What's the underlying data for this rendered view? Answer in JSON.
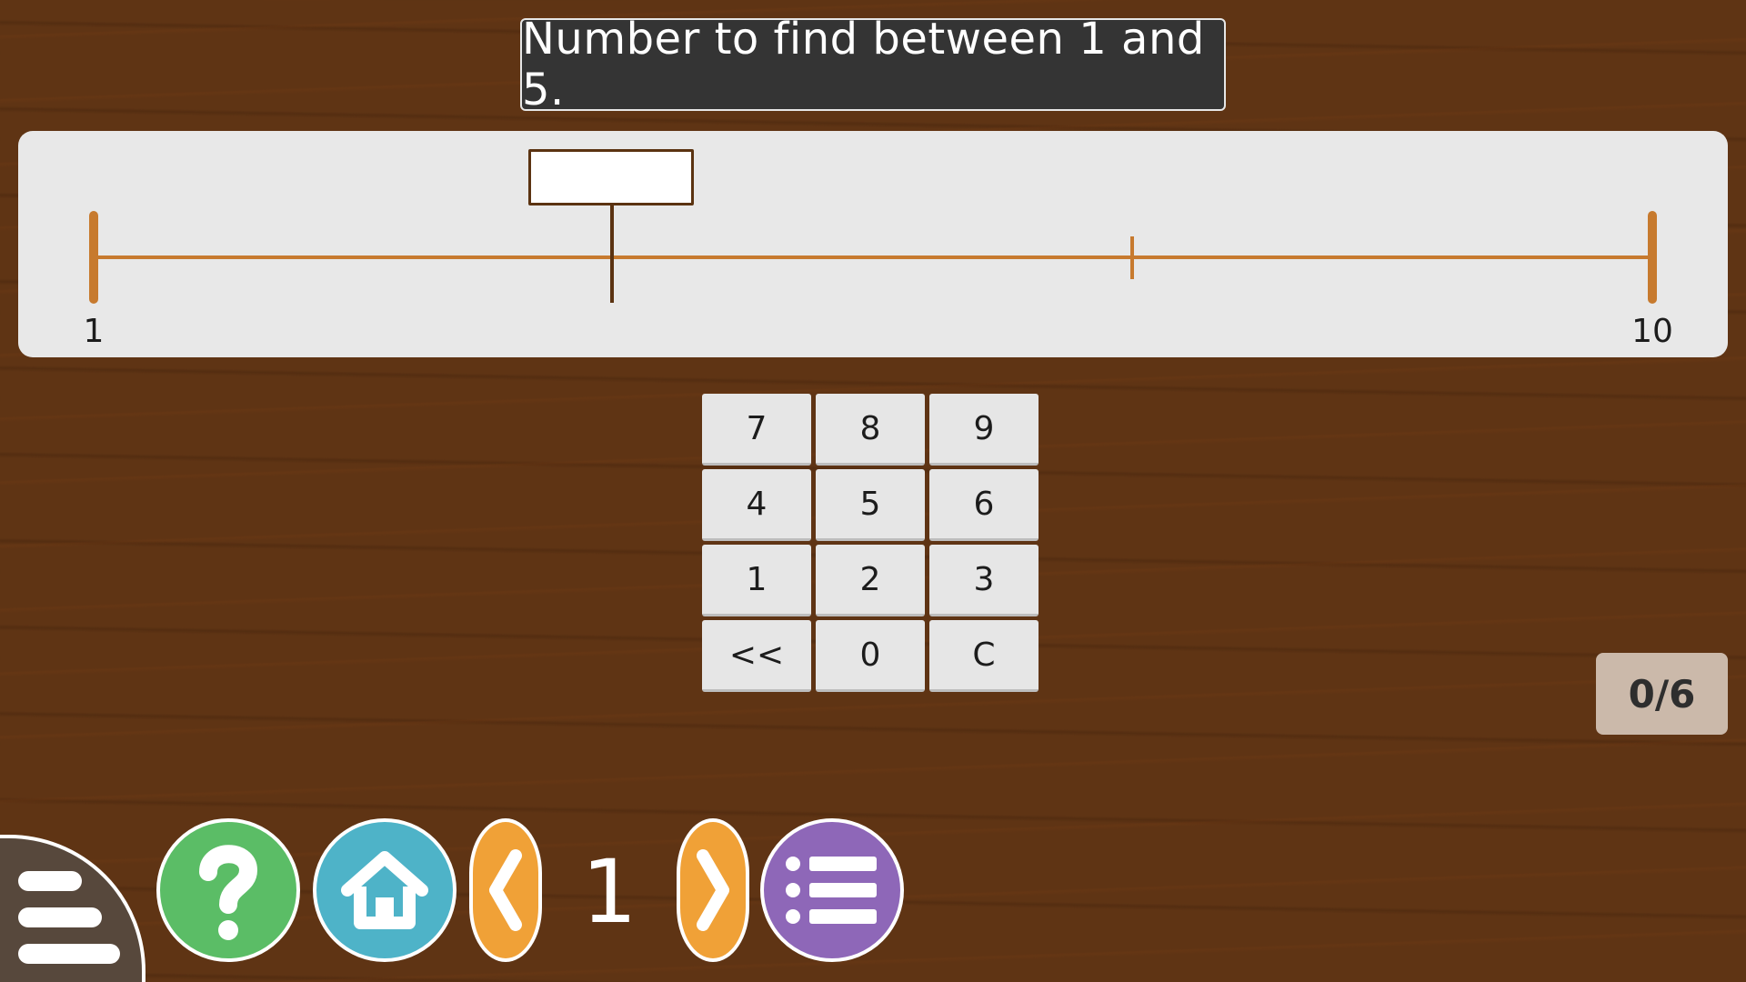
{
  "prompt": "Number to find between 1 and 5.",
  "number_line": {
    "min_label": "1",
    "max_label": "10",
    "answer_value": ""
  },
  "keypad": {
    "keys": [
      "7",
      "8",
      "9",
      "4",
      "5",
      "6",
      "1",
      "2",
      "3",
      "<<",
      "0",
      "C"
    ]
  },
  "score": "0/6",
  "toolbar": {
    "page_number": "1",
    "icons": [
      "menu-icon",
      "question-mark-icon",
      "home-icon",
      "chevron-left-icon",
      "chevron-right-icon",
      "list-icon"
    ]
  },
  "colors": {
    "background": "#5f3414",
    "number_line": "#c77a2e",
    "marker": "#5b3311",
    "help": "#5bbd66",
    "home": "#4eb3c8",
    "arrow": "#f0a137",
    "list": "#8e67b8",
    "menu": "#57483c"
  }
}
